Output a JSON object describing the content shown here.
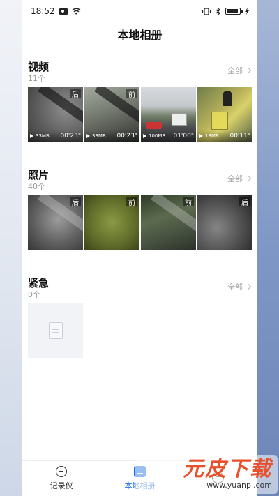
{
  "status_bar": {
    "time": "18:52"
  },
  "header": {
    "title": "本地相册"
  },
  "sections": {
    "videos": {
      "title": "视频",
      "count": "11个",
      "see_all": "全部",
      "items": [
        {
          "tag": "后",
          "size": "33MB",
          "duration": "00'23\""
        },
        {
          "tag": "前",
          "size": "33MB",
          "duration": "00'23\""
        },
        {
          "tag": "",
          "size": "100MB",
          "duration": "01'00\""
        },
        {
          "tag": "",
          "size": "13MB",
          "duration": "00'11\""
        }
      ]
    },
    "photos": {
      "title": "照片",
      "count": "40个",
      "see_all": "全部",
      "items": [
        {
          "tag": "后"
        },
        {
          "tag": "前"
        },
        {
          "tag": "前"
        },
        {
          "tag": "后"
        }
      ]
    },
    "emergency": {
      "title": "紧急",
      "count": "0个",
      "see_all": "全部"
    }
  },
  "bottom_nav": {
    "items": [
      {
        "label": "记录仪",
        "icon": "recorder-icon"
      },
      {
        "label": "本地相册",
        "icon": "album-icon",
        "active": true
      },
      {
        "label": "",
        "icon": "settings-icon"
      }
    ]
  },
  "watermark": {
    "title": "元皮下载",
    "url": "www.yuanpi.com"
  }
}
